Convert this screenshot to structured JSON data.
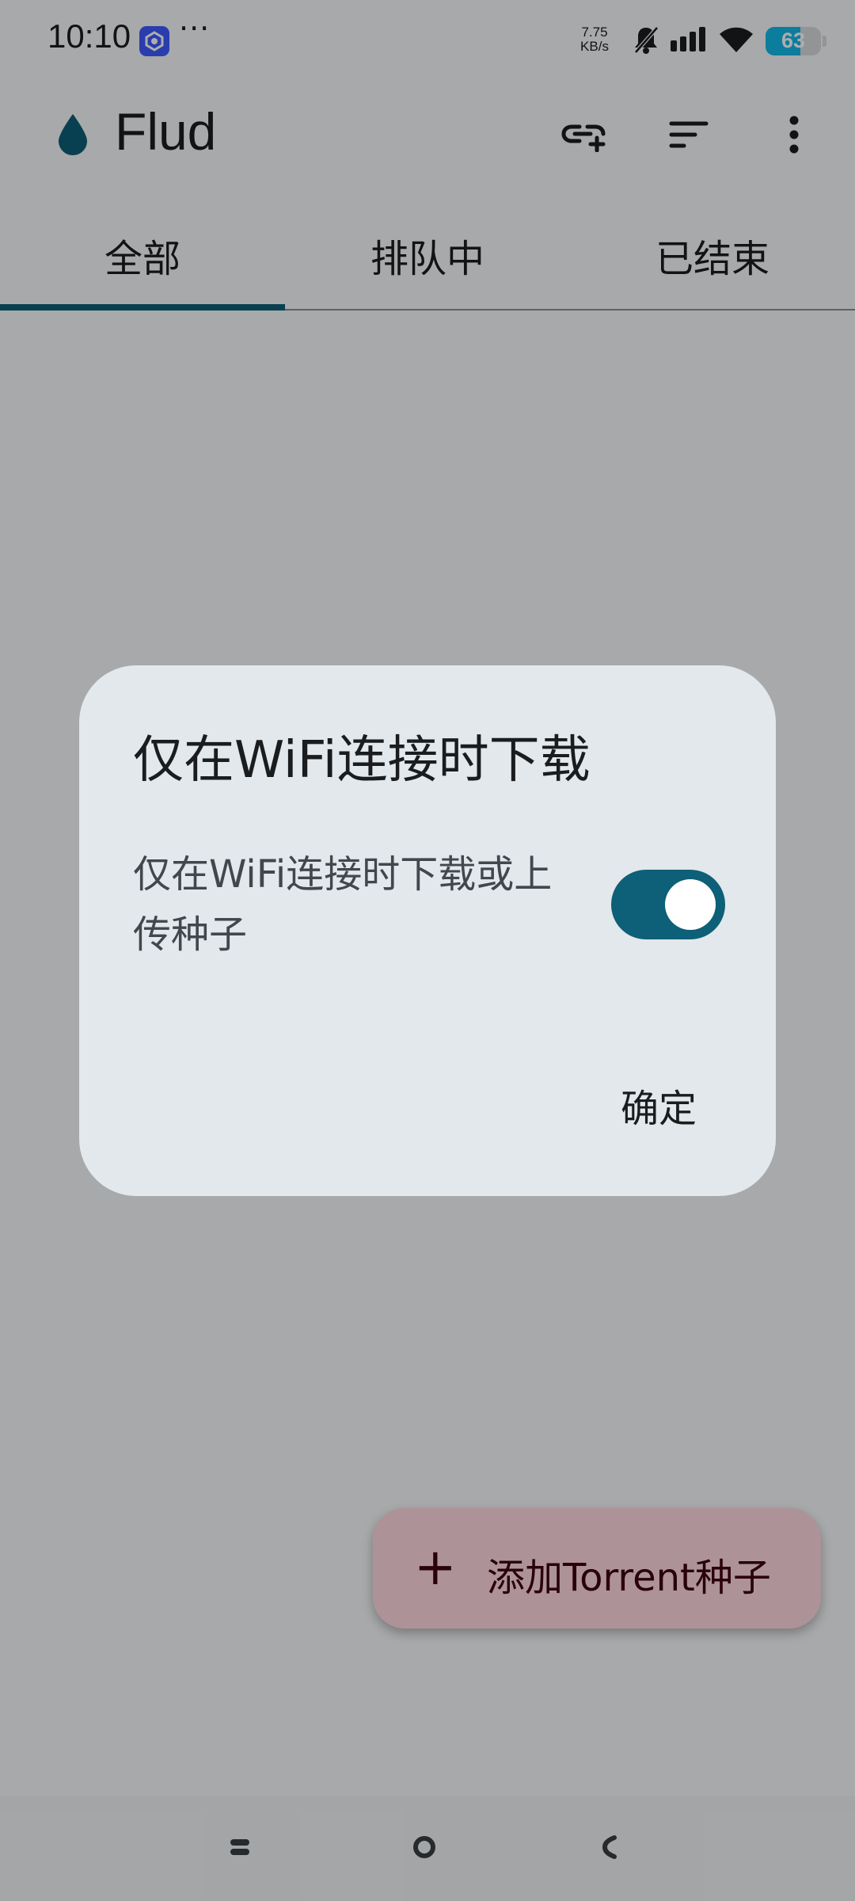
{
  "status_bar": {
    "time": "10:10",
    "more": "···",
    "net_speed_value": "7.75",
    "net_speed_unit": "KB/s",
    "battery_level": "63",
    "icons": [
      "app-notification-icon",
      "bell-off-icon",
      "signal-icon",
      "wifi-icon",
      "battery-icon"
    ]
  },
  "app_bar": {
    "title": "Flud",
    "actions": [
      "add-link-icon",
      "sort-icon",
      "more-vert-icon"
    ]
  },
  "tabs": [
    {
      "label": "全部",
      "selected": true
    },
    {
      "label": "排队中",
      "selected": false
    },
    {
      "label": "已结束",
      "selected": false
    }
  ],
  "empty_state": {
    "text": ""
  },
  "fab": {
    "icon": "plus",
    "label": "添加Torrent种子"
  },
  "dialog": {
    "title": "仅在WiFi连接时下载",
    "text": "仅在WiFi连接时下载或上传种子",
    "toggle_on": true,
    "confirm_label": "确定"
  },
  "nav_bar": {
    "buttons": [
      "recents",
      "home",
      "back"
    ]
  },
  "colors": {
    "primary": "#0e5f78",
    "fab_container": "#ffd9df",
    "dialog_surface": "#e2e8eb",
    "scrim": "rgba(0,0,0,0.32)"
  }
}
